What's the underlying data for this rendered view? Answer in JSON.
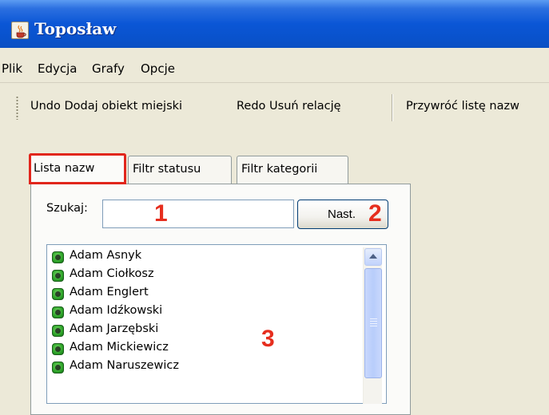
{
  "window": {
    "title": "Toposław",
    "icon": "java-cup-icon"
  },
  "menu": [
    "Plik",
    "Edycja",
    "Grafy",
    "Opcje"
  ],
  "toolbar": {
    "undo_label": "Undo Dodaj obiekt miejski",
    "redo_label": "Redo Usuń relację",
    "restore_label": "Przywróć listę nazw"
  },
  "tabs": [
    {
      "label": "Lista nazw",
      "active": true
    },
    {
      "label": "Filtr statusu",
      "active": false
    },
    {
      "label": "Filtr kategorii",
      "active": false
    }
  ],
  "search": {
    "label": "Szukaj:",
    "value": ""
  },
  "next_button": {
    "label": "Nast."
  },
  "annotations": [
    "1",
    "2",
    "3"
  ],
  "names": [
    "Adam Asnyk",
    "Adam Ciołkosz",
    "Adam Englert",
    "Adam Idźkowski",
    "Adam Jarzębski",
    "Adam Mickiewicz",
    "Adam Naruszewicz"
  ],
  "colors": {
    "titlebar": "#0a56d6",
    "annotation": "#e62e1e",
    "window_bg": "#ece9d8",
    "status_bullet": "#2ea52a"
  }
}
